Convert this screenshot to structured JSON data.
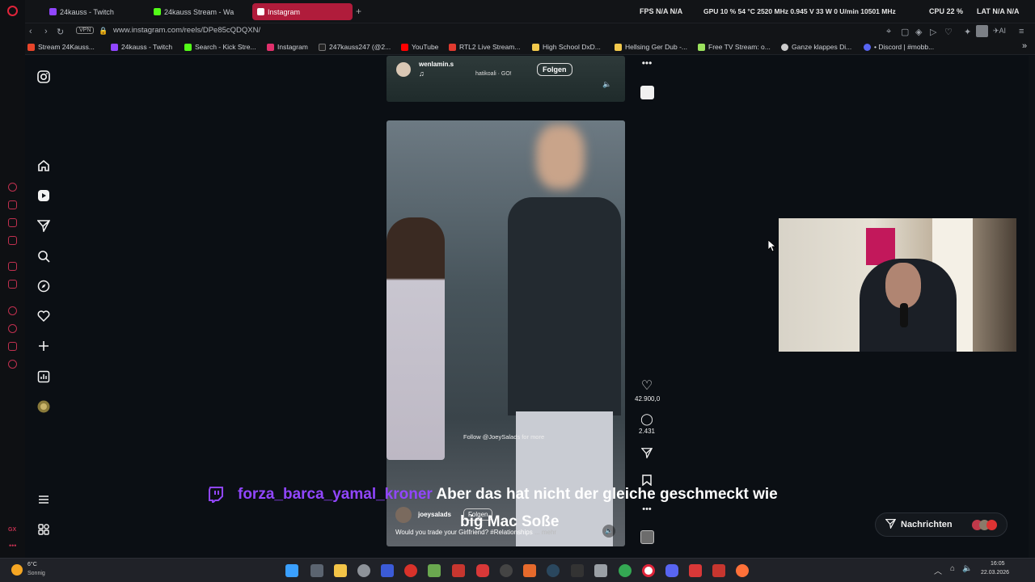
{
  "tabs": [
    {
      "label": "24kauss - Twitch",
      "active": false,
      "color": "#9146ff"
    },
    {
      "label": "24kauss Stream - Wa",
      "active": false,
      "color": "#53fc18"
    },
    {
      "label": "Instagram",
      "active": true,
      "color": "#ffffff"
    }
  ],
  "stats": {
    "fps": "FPS  N/A  N/A",
    "gpu": "GPU  10 %  54 °C  2520 MHz  0.945 V  33 W  0 U/min  10501 MHz",
    "cpu": "CPU  22 %",
    "lat": "LAT  N/A  N/A"
  },
  "address": {
    "vpn": "VPN",
    "url": "www.instagram.com/reels/DPe85cQDQXN/"
  },
  "bookmarks": [
    {
      "label": "Stream 24Kauss...",
      "color": "#e8452a"
    },
    {
      "label": "24kauss - Twitch",
      "color": "#9146ff"
    },
    {
      "label": "Search - Kick Stre...",
      "color": "#53fc18"
    },
    {
      "label": "Instagram",
      "color": "#e1306c"
    },
    {
      "label": "247kauss247 (@2...",
      "color": "#000000"
    },
    {
      "label": "YouTube",
      "color": "#ff0000"
    },
    {
      "label": "RTL2 Live Stream...",
      "color": "#e03a2f"
    },
    {
      "label": "High School DxD...",
      "color": "#f2c94c"
    },
    {
      "label": "Hellsing Ger Dub -...",
      "color": "#f2c94c"
    },
    {
      "label": "Free TV Stream: o...",
      "color": "#9be15d"
    },
    {
      "label": "Ganze klappes Di...",
      "color": "#cccccc"
    },
    {
      "label": "• Discord | #mobb...",
      "color": "#5865f2"
    }
  ],
  "top_reel": {
    "username": "wenlamin.s",
    "audio": "hatikoali · GO!",
    "follow": "Folgen"
  },
  "main_reel": {
    "username": "joeysalads",
    "follow": "Folgen",
    "caption": "Would you trade your Girlfriend? #Relationships",
    "more": "... mehr",
    "overlay_text": "Follow @JoeySalads for more",
    "likes": "42.900,0",
    "comments": "2.431"
  },
  "subtitle": {
    "user": "forza_barca_yamal_kroner",
    "line1": "Aber das hat nicht der gleiche geschmeckt wie",
    "line2": "big Mac Soße",
    "user_color": "#9146ff"
  },
  "messages": {
    "label": "Nachrichten"
  },
  "taskbar": {
    "weather_temp": "6°C",
    "weather_text": "Sonnig",
    "time": "16:05",
    "date": "22.03.2026"
  }
}
